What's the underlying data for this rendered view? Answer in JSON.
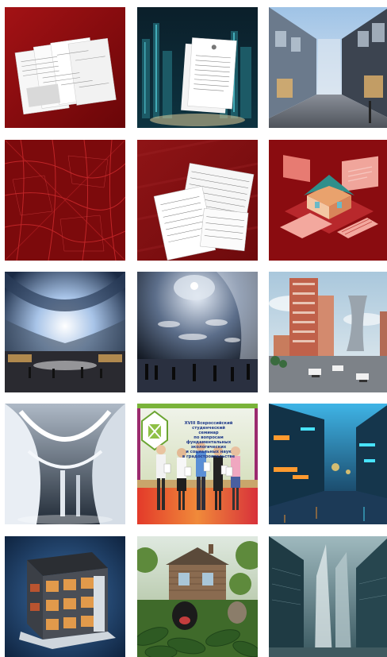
{
  "gallery": {
    "banner_text_lines": [
      "XVIII Всероссийский студенческий",
      "семинар",
      "по вопросам фундаментальных",
      "экологических",
      "и социальных наук",
      "в градостроительстве"
    ]
  }
}
